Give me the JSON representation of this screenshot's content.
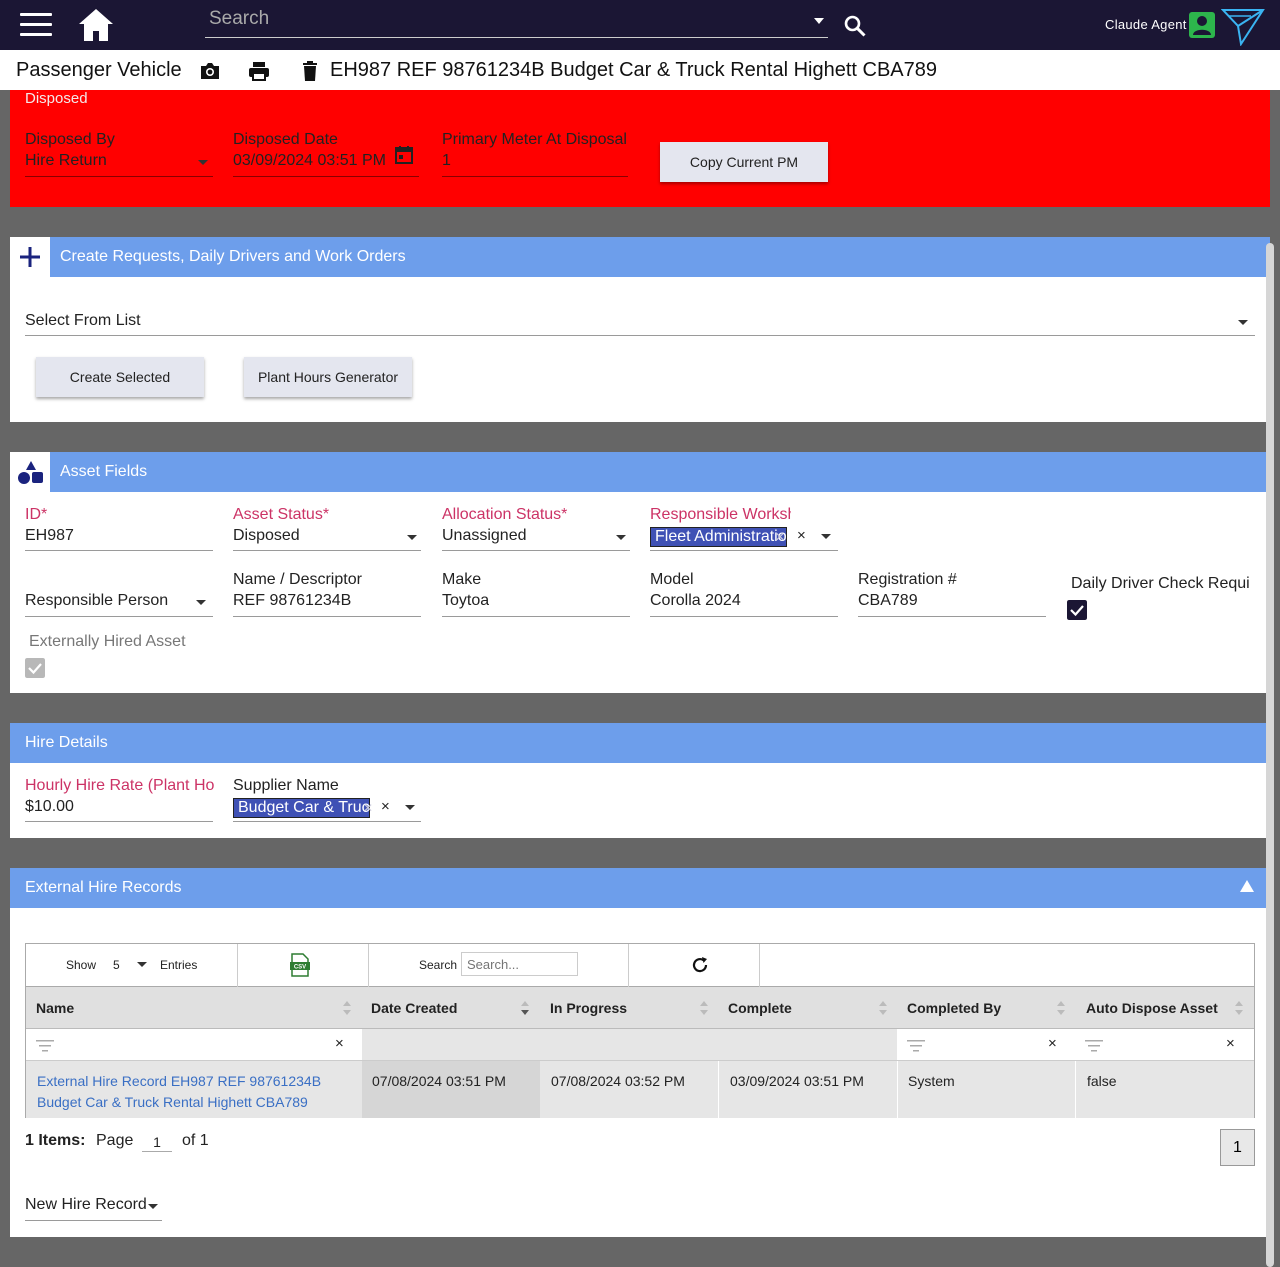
{
  "topbar": {
    "search_placeholder": "Search",
    "user_name": "Claude Agent"
  },
  "titlebar": {
    "page_type": "Passenger Vehicle",
    "title": "EH987 REF 98761234B Budget Car & Truck Rental Highett CBA789"
  },
  "disposed": {
    "heading": "Disposed",
    "disposed_by_label": "Disposed By",
    "disposed_by_value": "Hire Return",
    "disposed_date_label": "Disposed Date",
    "disposed_date_value": "03/09/2024 03:51 PM",
    "meter_label": "Primary Meter At Disposal",
    "meter_value": "1",
    "copy_button": "Copy Current PM"
  },
  "create": {
    "header": "Create Requests, Daily Drivers and Work Orders",
    "select_label": "Select From List",
    "create_button": "Create Selected",
    "plant_button": "Plant Hours Generator"
  },
  "asset": {
    "header": "Asset Fields",
    "id_label": "ID*",
    "id_value": "EH987",
    "status_label": "Asset Status*",
    "status_value": "Disposed",
    "allocation_label": "Allocation Status*",
    "allocation_value": "Unassigned",
    "workshop_label": "Responsible Workshop",
    "workshop_chip": "Fleet Administration",
    "person_label": "Responsible Person",
    "name_label": "Name / Descriptor",
    "name_value": "REF 98761234B",
    "make_label": "Make",
    "make_value": "Toytoa",
    "model_label": "Model",
    "model_value": "Corolla 2024",
    "rego_label": "Registration #",
    "rego_value": "CBA789",
    "daily_label": "Daily Driver Check Required",
    "daily_checked": true,
    "external_label": "Externally Hired Asset",
    "external_checked": true
  },
  "hire": {
    "header": "Hire Details",
    "rate_label": "Hourly Hire Rate (Plant Hours)",
    "rate_value": "$10.00",
    "supplier_label": "Supplier Name",
    "supplier_chip": "Budget Car & Truck Rental Highett"
  },
  "records": {
    "header": "External Hire Records",
    "show_label": "Show",
    "show_value": "5",
    "entries_label": "Entries",
    "search_label": "Search",
    "search_placeholder": "Search...",
    "columns": [
      "Name",
      "Date Created",
      "In Progress",
      "Complete",
      "Completed By",
      "Auto Dispose Asset"
    ],
    "rows": [
      {
        "name": "External Hire Record EH987 REF 98761234B Budget Car & Truck Rental Highett CBA789",
        "date_created": "07/08/2024 03:51 PM",
        "in_progress": "07/08/2024 03:52 PM",
        "complete": "03/09/2024 03:51 PM",
        "completed_by": "System",
        "auto_dispose": "false"
      }
    ],
    "items_label": "1 Items:",
    "page_label": "Page",
    "page_value": "1",
    "of_label": "of 1",
    "page_button": "1",
    "new_record": "New Hire Record"
  },
  "colors": {
    "topbar": "#1b1634",
    "accent": "#6d9eeb",
    "disposed": "#ff0000",
    "chip": "#3f51b5",
    "required": "#cc3366",
    "user_icon": "#2db54c"
  }
}
